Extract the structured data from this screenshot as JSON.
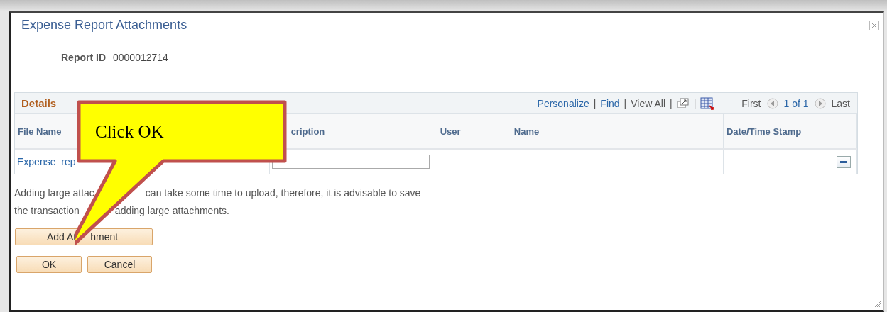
{
  "window": {
    "title": "Expense Report Attachments"
  },
  "report": {
    "label": "Report ID",
    "value": "0000012714"
  },
  "grid": {
    "title": "Details",
    "toolbar": [
      {
        "kind": "link",
        "label": "Personalize"
      },
      {
        "kind": "separator",
        "label": "|"
      },
      {
        "kind": "link",
        "label": "Find"
      },
      {
        "kind": "separator",
        "label": "|"
      },
      {
        "kind": "text",
        "label": "View All"
      },
      {
        "kind": "separator",
        "label": "|"
      },
      {
        "kind": "new-window"
      },
      {
        "kind": "separator",
        "label": "|"
      },
      {
        "kind": "download"
      }
    ],
    "nav": {
      "first": "First",
      "count": "1 of 1",
      "last": "Last"
    },
    "columns": [
      "File Name",
      "cription",
      "User",
      "Name",
      "Date/Time Stamp"
    ],
    "rows": [
      {
        "file_name": "Expense_rep"
      }
    ]
  },
  "notice": [
    [
      "Adding large attac",
      "can take some time to upload, therefore, it is advisable to save"
    ],
    [
      "the transaction",
      "adding large attachments."
    ]
  ],
  "buttons": {
    "add": [
      "Add At",
      "hment"
    ],
    "ok": "OK",
    "cancel": "Cancel"
  },
  "callout": {
    "text": "Click OK"
  }
}
